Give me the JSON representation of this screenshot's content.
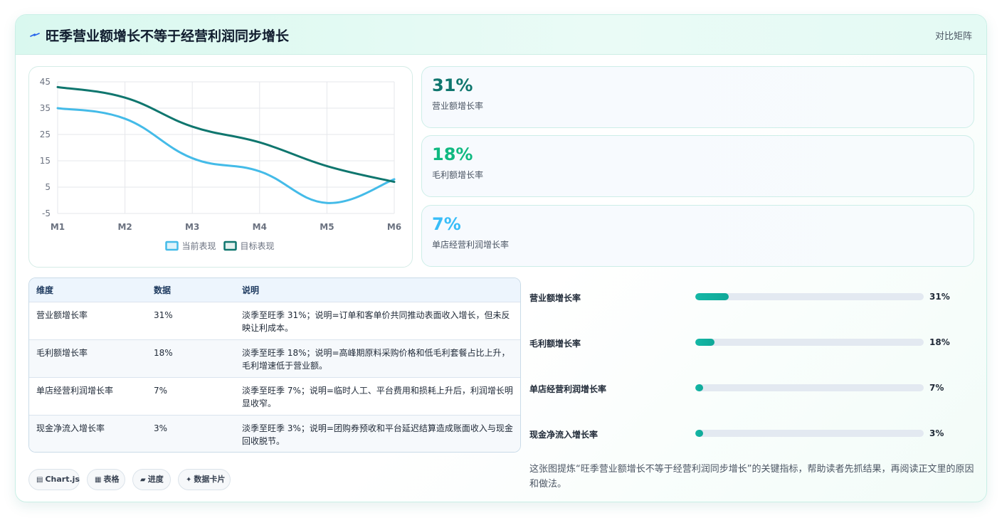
{
  "header": {
    "title": "旺季营业额增长不等于经营利润同步增长",
    "mode_label": "对比矩阵",
    "icon": "lightning-icon"
  },
  "chart_data": {
    "type": "line",
    "categories": [
      "M1",
      "M2",
      "M3",
      "M4",
      "M5",
      "M6"
    ],
    "series": [
      {
        "name": "当前表现",
        "values": [
          35,
          31,
          16,
          11,
          -1,
          8
        ],
        "color": "#44bbe8"
      },
      {
        "name": "目标表现",
        "values": [
          43,
          39,
          28,
          22,
          13,
          7
        ],
        "color": "#0f766e"
      }
    ],
    "y_ticks": [
      45,
      35,
      25,
      15,
      5,
      -5
    ],
    "ylim": [
      -5,
      45
    ],
    "grid": true,
    "legend_position": "bottom-center"
  },
  "kpis": [
    {
      "value": "31%",
      "label": "营业额增长率",
      "color": "#0f766e"
    },
    {
      "value": "18%",
      "label": "毛利额增长率",
      "color": "#10b981"
    },
    {
      "value": "7%",
      "label": "单店经营利润增长率",
      "color": "#38bdf8"
    }
  ],
  "table": {
    "headers": [
      "维度",
      "数据",
      "说明"
    ],
    "rows": [
      {
        "dim": "营业额增长率",
        "val": "31%",
        "desc": "淡季至旺季 31%；说明=订单和客单价共同推动表面收入增长，但未反映让利成本。"
      },
      {
        "dim": "毛利额增长率",
        "val": "18%",
        "desc": "淡季至旺季 18%；说明=高峰期原料采购价格和低毛利套餐占比上升，毛利增速低于营业额。"
      },
      {
        "dim": "单店经营利润增长率",
        "val": "7%",
        "desc": "淡季至旺季 7%；说明=临时人工、平台费用和损耗上升后，利润增长明显收窄。"
      },
      {
        "dim": "现金净流入增长率",
        "val": "3%",
        "desc": "淡季至旺季 3%；说明=团购券预收和平台延迟结算造成账面收入与现金回收脱节。"
      }
    ]
  },
  "progress": [
    {
      "label": "营业额增长率",
      "value": "31%",
      "fraction": 0.145
    },
    {
      "label": "毛利额增长率",
      "value": "18%",
      "fraction": 0.085
    },
    {
      "label": "单店经营利润增长率",
      "value": "7%",
      "fraction": 0.035
    },
    {
      "label": "现金净流入增长率",
      "value": "3%",
      "fraction": 0.035
    }
  ],
  "note": "这张图提炼“旺季营业额增长不等于经营利润同步增长”的关键指标，帮助读者先抓结果，再阅读正文里的原因和做法。",
  "chips": [
    {
      "icon": "▤",
      "label": "Chart.js"
    },
    {
      "icon": "▦",
      "label": "表格"
    },
    {
      "icon": "▰",
      "label": "进度"
    },
    {
      "icon": "✦",
      "label": "数据卡片"
    }
  ]
}
